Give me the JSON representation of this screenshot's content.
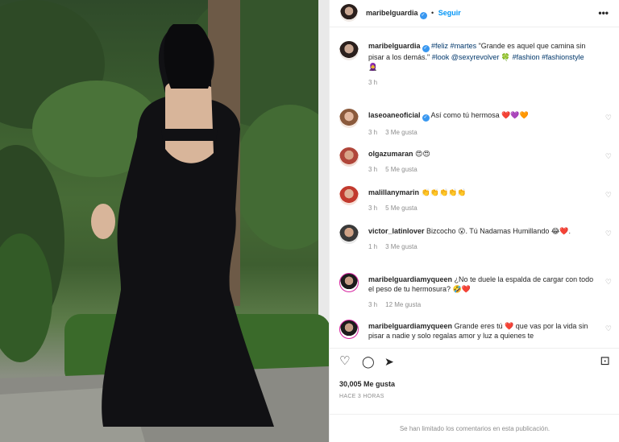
{
  "post": {
    "author": "maribelguardia",
    "follow_label": "Seguir",
    "more_label": "•••",
    "caption": {
      "hashtags_1": "#feliz #martes",
      "text_1": " \"Grande es aquel que camina sin pisar a los demás.\" ",
      "hashtag_look": "#look",
      "mention": " @sexyrevolver ",
      "emoji_1": "🍀",
      "hashtags_2": " #fashion #fashionstyle",
      "emoji_2": "🧕",
      "time": "3 h"
    },
    "likes": "30,005 Me gusta",
    "posted_ago": "HACE 3 HORAS",
    "footer": "Se han limitado los comentarios en esta publicación."
  },
  "comments": [
    {
      "user": "laseoaneoficial",
      "text": "Así como tú hermosa ❤️💜🧡",
      "time": "3 h",
      "likes": "3 Me gusta"
    },
    {
      "user": "olgazumaran",
      "text": "😍😍",
      "time": "3 h",
      "likes": "5 Me gusta"
    },
    {
      "user": "malillanymarin",
      "text": "👏👏👏👏👏",
      "time": "3 h",
      "likes": "5 Me gusta"
    },
    {
      "user": "victor_latinlover",
      "text": "Bizcocho 😮. Tú Nadamas Humillando 😂❤️.",
      "time": "1 h",
      "likes": "3 Me gusta"
    },
    {
      "user": "maribelguardiamyqueen",
      "text": "¿No te duele la espalda de cargar con todo el peso de tu hermosura? 🤣❤️",
      "time": "3 h",
      "likes": "12 Me gusta"
    },
    {
      "user": "maribelguardiamyqueen",
      "text": "Grande eres tú ❤️ que vas por la vida sin pisar a nadie y solo regalas amor y luz a quienes te",
      "time": "",
      "likes": ""
    }
  ],
  "icons": {
    "like": "♡",
    "comment": "◯",
    "share": "➤",
    "save": "⊡",
    "comment_like": "♡"
  },
  "colors": {
    "link": "#00376b",
    "accent": "#0095f6",
    "verified": "#3897f0"
  }
}
